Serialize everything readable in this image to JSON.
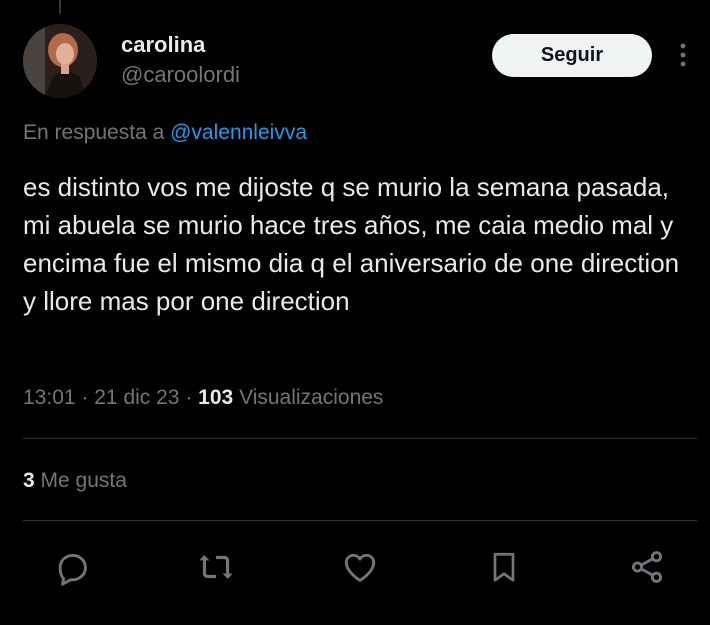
{
  "author": {
    "name": "carolina",
    "handle": "@caroolordi"
  },
  "follow_button": {
    "label": "Seguir"
  },
  "reply": {
    "prefix": "En respuesta a",
    "mention": "@valennleivva"
  },
  "tweet": {
    "text": "es distinto vos me dijoste q se murio la semana pasada, mi abuela se murio hace tres años, me caia medio mal y encima fue el mismo dia q el aniversario de one direction y llore mas por one direction"
  },
  "meta": {
    "time": "13:01",
    "separator": "·",
    "date": "21 dic 23",
    "views_count": "103",
    "views_label": "Visualizaciones"
  },
  "likes": {
    "count": "3",
    "label": "Me gusta"
  },
  "icons": {
    "more": "more-vertical-icon",
    "reply": "reply-icon",
    "retweet": "retweet-icon",
    "like": "heart-icon",
    "bookmark": "bookmark-icon",
    "share": "share-icon"
  },
  "colors": {
    "background": "#000000",
    "text_primary": "#e7e9ea",
    "text_secondary": "#71767b",
    "accent": "#1d9bf0",
    "divider": "#2f3336",
    "button_bg": "#eff3f4"
  }
}
